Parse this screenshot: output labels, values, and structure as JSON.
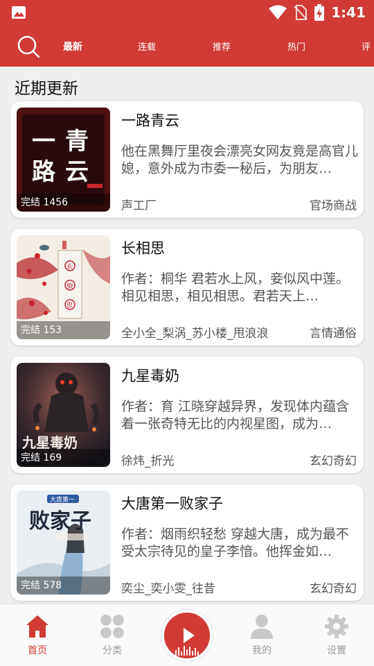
{
  "status_bar": {
    "time": "1:41",
    "icons": [
      "image-icon",
      "wifi-icon",
      "no-sim-icon",
      "battery-charging-icon"
    ]
  },
  "nav": {
    "search_icon": "search-icon",
    "tabs": [
      "最新",
      "连载",
      "推荐",
      "热门",
      "评"
    ],
    "active_tab": 0
  },
  "section_title": "近期更新",
  "books": [
    {
      "title": "一路青云",
      "description": "他在黑舞厅里夜会漂亮女网友竟是高官儿媳，意外成为市委一秘后，为朋友…",
      "author": "声工厂",
      "tag": "官场商战",
      "badge": "完结 1456",
      "cover_text": [
        "一",
        "路",
        "青",
        "云"
      ]
    },
    {
      "title": "长相思",
      "description": "作者：桐华 君若水上风，妾似风中莲。相见相思，相见相思。君若天上…",
      "author": "全小全_梨涡_苏小楼_甩浪浪",
      "tag": "言情通俗",
      "badge": "完结 153",
      "cover_text": [
        "长",
        "相",
        "思"
      ]
    },
    {
      "title": "九星毒奶",
      "description": "作者：育 江晓穿越异界，发现体内蕴含着一张奇特无比的内视星图，成为…",
      "author": "徐炜_折光",
      "tag": "玄幻奇幻",
      "badge": "完结 169",
      "cover_text": [
        "九星毒奶"
      ]
    },
    {
      "title": "大唐第一败家子",
      "description": "作者：烟雨织轻愁 穿越大唐，成为最不受太宗待见的皇子李愔。他挥金如…",
      "author": "奕尘_奕小雯_往昔",
      "tag": "玄幻奇幻",
      "badge": "完结 578",
      "cover_text": [
        "大唐第一",
        "败家子"
      ]
    }
  ],
  "bottom_nav": [
    {
      "label": "首页",
      "icon": "home-icon",
      "active": true
    },
    {
      "label": "分类",
      "icon": "category-grid-icon",
      "active": false
    },
    {
      "label": "",
      "icon": "play-icon",
      "active": false
    },
    {
      "label": "我的",
      "icon": "user-icon",
      "active": false
    },
    {
      "label": "设置",
      "icon": "gear-icon",
      "active": false
    }
  ],
  "colors": {
    "brand": "#d23a35",
    "background": "#efefef",
    "card": "#ffffff",
    "text": "#111111",
    "muted": "#555555"
  }
}
